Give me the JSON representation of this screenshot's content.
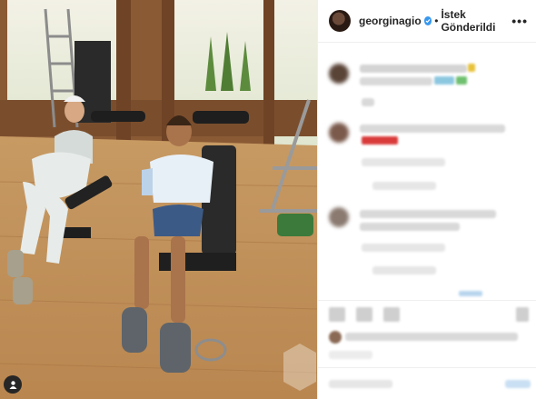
{
  "post": {
    "username": "georginagio",
    "separator": "•",
    "follow_status": "İstek Gönderildi",
    "more_icon_text": "•••"
  },
  "icons": {
    "verified": "verified-badge-icon",
    "more": "more-options-icon",
    "user_tag": "user-tag-icon"
  },
  "colors": {
    "verified_blue": "#3897f0",
    "text": "#262626",
    "border": "#efefef"
  }
}
